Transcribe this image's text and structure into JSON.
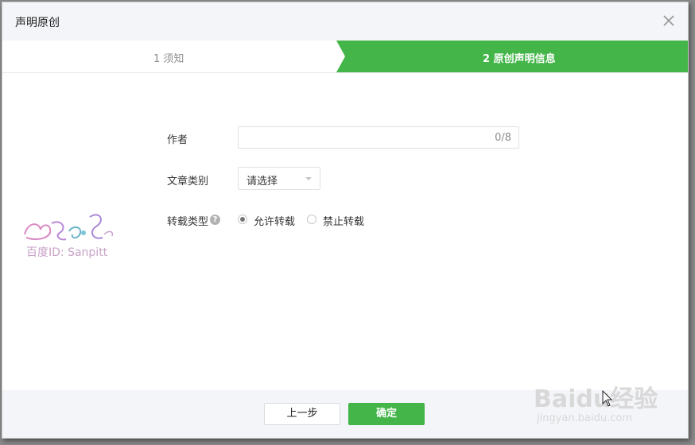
{
  "dialog": {
    "title": "声明原创"
  },
  "steps": [
    {
      "label": "1 须知",
      "active": false
    },
    {
      "label": "2 原创声明信息",
      "active": true
    }
  ],
  "form": {
    "author": {
      "label": "作者",
      "value": "",
      "counter": "0/8"
    },
    "category": {
      "label": "文章类别",
      "selected": "请选择"
    },
    "reprint": {
      "label": "转载类型",
      "help_icon": "question-circle-icon",
      "options": [
        {
          "label": "允许转载",
          "checked": true
        },
        {
          "label": "禁止转载",
          "checked": false
        }
      ]
    }
  },
  "footer": {
    "prev_label": "上一步",
    "confirm_label": "确定"
  },
  "watermark": {
    "text": "百度ID: Sanpitt",
    "logo_text": "Baidu经验",
    "logo_url": "jingyan.baidu.com"
  },
  "colors": {
    "accent": "#44b549",
    "header_bg": "#f4f5f9",
    "text": "#353535",
    "muted": "#8d8d8d"
  }
}
